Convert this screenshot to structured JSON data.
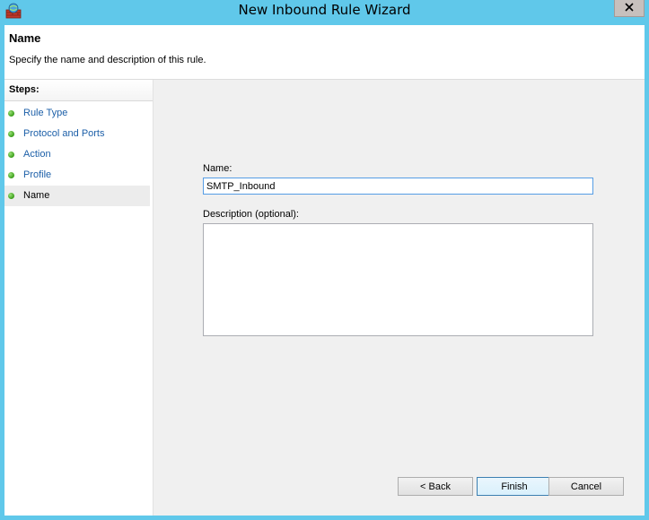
{
  "window": {
    "title": "New Inbound Rule Wizard",
    "app_icon": "firewall-icon",
    "close_icon": "close-icon"
  },
  "header": {
    "title": "Name",
    "subtitle": "Specify the name and description of this rule."
  },
  "steps": {
    "heading": "Steps:",
    "items": [
      {
        "label": "Rule Type"
      },
      {
        "label": "Protocol and Ports"
      },
      {
        "label": "Action"
      },
      {
        "label": "Profile"
      },
      {
        "label": "Name",
        "current": true
      }
    ]
  },
  "form": {
    "name_label": "Name:",
    "name_value": "SMTP_Inbound",
    "description_label": "Description (optional):",
    "description_value": ""
  },
  "buttons": {
    "back": "< Back",
    "finish": "Finish",
    "cancel": "Cancel"
  },
  "colors": {
    "title_bar": "#60c8ea",
    "step_link": "#1c5fa8",
    "step_dot": "#3a9d1a"
  }
}
